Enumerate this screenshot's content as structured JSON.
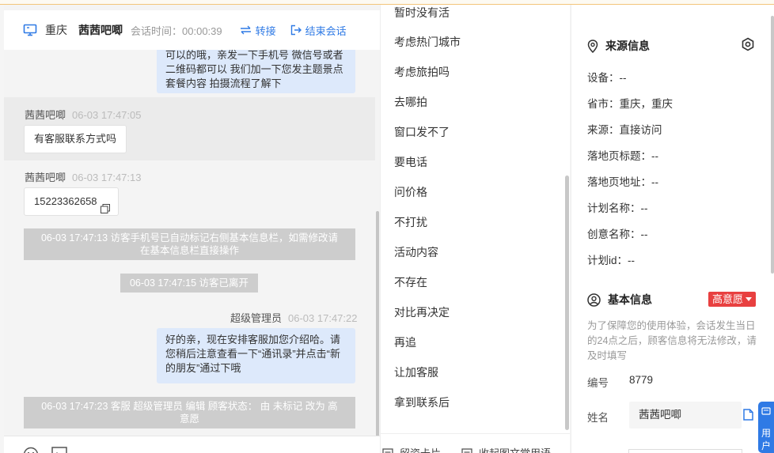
{
  "header": {
    "city": "重庆",
    "visitor_name": "茜茜吧唧",
    "duration_label": "会话时间：",
    "duration_value": "00:00:39",
    "transfer_label": "转接",
    "end_label": "结束会话"
  },
  "messages": {
    "agent_msg_1_line1": "可以的哦，亲发一下手机号 微信号或者",
    "agent_msg_1_line2": "二维码都可以 我们加一下您发主题景点",
    "agent_msg_1_line3": "套餐内容 拍摄流程了解下",
    "visitor_name_1": "茜茜吧唧",
    "visitor_time_1": "06-03 17:47:05",
    "visitor_msg_1": "有客服联系方式吗",
    "visitor_name_2": "茜茜吧唧",
    "visitor_time_2": "06-03 17:47:13",
    "visitor_msg_2": "15223362658",
    "sys_1_line1": "06-03 17:47:13 访客手机号已自动标记右侧基本信息栏，如需修改请",
    "sys_1_line2": "在基本信息栏直接操作",
    "sys_2": "06-03 17:47:15 访客已离开",
    "agent_name": "超级管理员",
    "agent_time": "06-03 17:47:22",
    "agent_msg_2_line1": "好的亲，现在安排客服加您介绍哈。请",
    "agent_msg_2_line2": "您稍后注意查看一下“通讯录”并点击“新",
    "agent_msg_2_line3": "的朋友”通过下哦",
    "sys_3_line1": "06-03 17:47:23 客服 超级管理员 编辑 顾客状态： 由 未标记 改为 高",
    "sys_3_line2": "意愿"
  },
  "quick_replies": {
    "items": [
      "暂时没有活",
      "考虑热门城市",
      "考虑旅拍吗",
      "去哪拍",
      "窗口发不了",
      "要电话",
      "问价格",
      "不打扰",
      "活动内容",
      "不存在",
      "对比再决定",
      "再追",
      "让加客服",
      "拿到联系后"
    ],
    "footer_card": "留资卡片",
    "footer_collapse": "收起图文常用语"
  },
  "source_info": {
    "title": "来源信息",
    "device": "设备：--",
    "province": "省市：重庆，重庆",
    "source": "来源：直接访问",
    "landing_title": "落地页标题：--",
    "landing_url": "落地页地址：--",
    "plan_name": "计划名称：--",
    "creative_name": "创意名称：--",
    "plan_id": "计划id：--"
  },
  "basic_info": {
    "title": "基本信息",
    "intent_badge": "高意愿",
    "notice": "为了保障您的使用体验，会话发生当日的24点之后，顾客信息将无法修改，请及时填写",
    "id_label": "编号",
    "id_value": "8779",
    "name_label": "姓名",
    "name_value": "茜茜吧唧"
  },
  "edge_tab": {
    "line1": "用",
    "line2": "户"
  },
  "colors": {
    "accent": "#2f7ae5",
    "badge_red": "#e84040",
    "bubble_blue": "#dde9fb"
  }
}
